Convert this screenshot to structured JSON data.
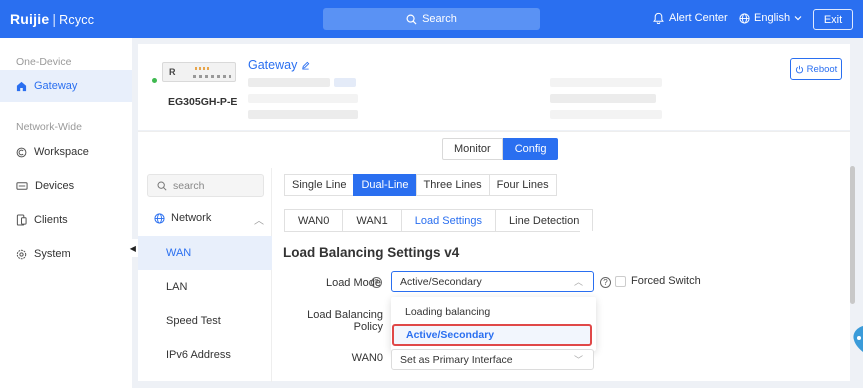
{
  "topbar": {
    "brand": "Ruijie",
    "brand2": "Rcycc",
    "search_label": "Search",
    "alert_label": "Alert Center",
    "language": "English",
    "exit_label": "Exit"
  },
  "leftnav": {
    "group1": "One-Device",
    "gateway": "Gateway",
    "group2": "Network-Wide",
    "workspace": "Workspace",
    "devices": "Devices",
    "clients": "Clients",
    "system": "System"
  },
  "device": {
    "name": "Gateway",
    "model": "EG305GH-P-E",
    "front_label": "R",
    "reboot_label": "Reboot"
  },
  "mode_tabs": [
    "Monitor",
    "Config"
  ],
  "subnav": {
    "search_placeholder": "search",
    "group": "Network",
    "items": [
      "WAN",
      "LAN",
      "Speed Test",
      "IPv6 Address"
    ]
  },
  "line_tabs": [
    "Single Line",
    "Dual-Line",
    "Three Lines",
    "Four Lines"
  ],
  "card_tabs": [
    "WAN0",
    "WAN1",
    "Load Settings",
    "Line Detection"
  ],
  "form": {
    "title": "Load Balancing Settings v4",
    "load_mode_label": "Load Mode",
    "load_mode_value": "Active/Secondary",
    "forced_switch_label": "Forced Switch",
    "policy_label": "Load Balancing Policy",
    "wan0_label": "WAN0",
    "wan0_value": "Set as Primary Interface"
  },
  "dropdown_options": [
    "Loading balancing",
    "Active/Secondary"
  ],
  "colors": {
    "primary": "#2a6ff0",
    "highlight_border": "#e04848",
    "online": "#3fb950"
  }
}
